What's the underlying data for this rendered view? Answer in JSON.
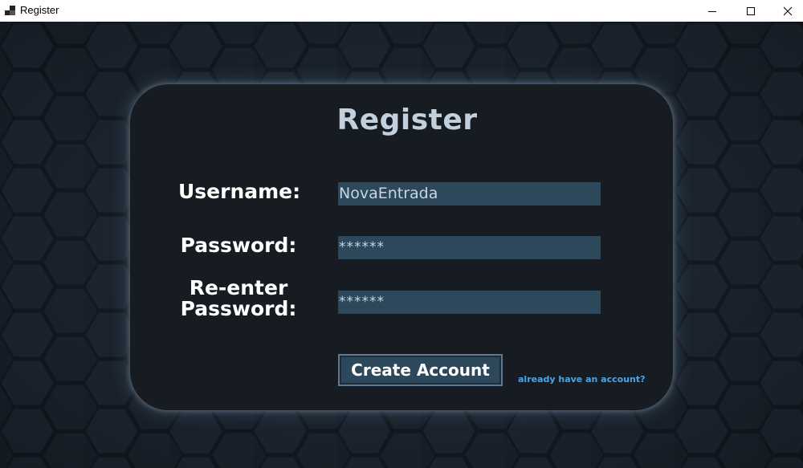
{
  "window": {
    "title": "Register",
    "controls": [
      "minimize-icon",
      "maximize-icon",
      "close-icon"
    ]
  },
  "form": {
    "heading": "Register",
    "username_label": "Username:",
    "username_value": "NovaEntrada",
    "password_label": "Password:",
    "password_value": "******",
    "reenter_label_line1": "Re-enter",
    "reenter_label_line2": "Password:",
    "reenter_value": "******",
    "create_button": "Create Account",
    "login_link": "already have an account?"
  },
  "colors": {
    "background": "#1d2733",
    "panel": "#171b22",
    "field": "#2d475b",
    "heading": "#c2d0de",
    "link": "#4aa6e6"
  }
}
